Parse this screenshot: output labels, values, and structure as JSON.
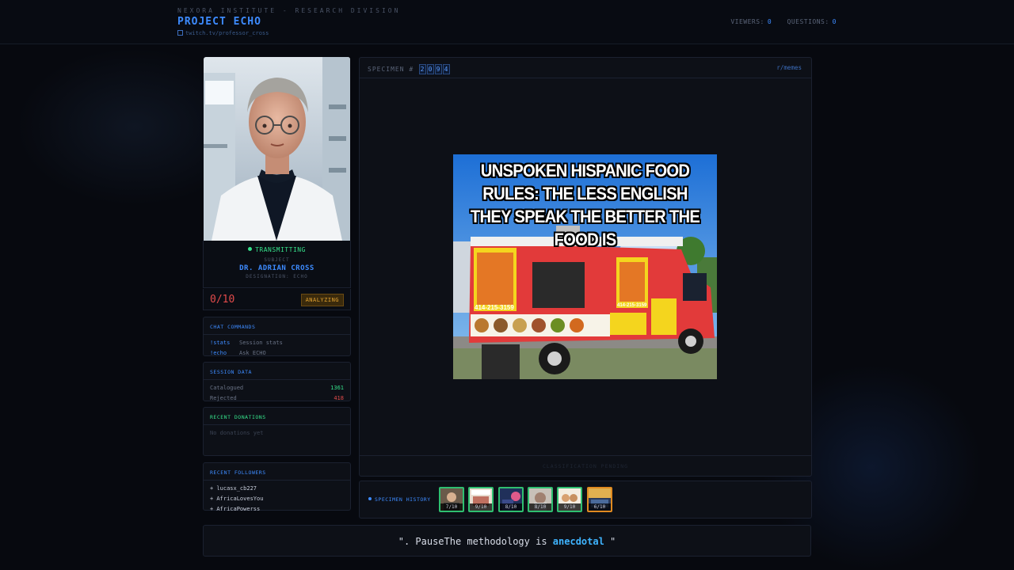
{
  "header": {
    "org": "NEXORA INSTITUTE - RESEARCH DIVISION",
    "project": "PROJECT ECHO",
    "link": "twitch.tv/professor_cross",
    "viewers_label": "VIEWERS:",
    "viewers_value": "0",
    "questions_label": "QUESTIONS:",
    "questions_value": "0"
  },
  "subject": {
    "status": "TRANSMITTING",
    "label": "SUBJECT",
    "name": "DR. ADRIAN CROSS",
    "designation": "DESIGNATION: ECHO",
    "score": "0/10",
    "state_badge": "ANALYZING"
  },
  "chat_commands": {
    "title": "CHAT COMMANDS",
    "items": [
      {
        "cmd": "!stats",
        "desc": "Session stats"
      },
      {
        "cmd": "!echo",
        "desc": "Ask ECHO"
      }
    ]
  },
  "session_data": {
    "title": "SESSION DATA",
    "catalogued_label": "Catalogued",
    "catalogued_value": "1361",
    "rejected_label": "Rejected",
    "rejected_value": "418"
  },
  "donations": {
    "title": "RECENT DONATIONS",
    "empty": "No donations yet"
  },
  "followers": {
    "title": "RECENT FOLLOWERS",
    "items": [
      "+ lucasx_cb227",
      "+ AfricaLovesYou",
      "+ AfricaPowerss"
    ]
  },
  "specimen": {
    "label": "SPECIMEN #",
    "digits": [
      "2",
      "0",
      "9",
      "4"
    ],
    "source": "r/memes",
    "meme_text": "UNSPOKEN HISPANIC FOOD RULES: THE LESS ENGLISH THEY SPEAK THE BETTER THE FOOD IS",
    "truck_phone": "414-215-3159",
    "classification": "CLASSIFICATION PENDING"
  },
  "history": {
    "label": "SPECIMEN HISTORY",
    "scores": [
      "7/10",
      "9/10",
      "8/10",
      "8/10",
      "9/10",
      "6/10"
    ]
  },
  "quote": {
    "prefix": "\". PauseThe methodology is ",
    "highlight": "anecdotal",
    "suffix": " \""
  },
  "colors": {
    "accent": "#3d8bff",
    "live": "#35e08a",
    "danger": "#e24b4b",
    "warning": "#e0a030"
  }
}
